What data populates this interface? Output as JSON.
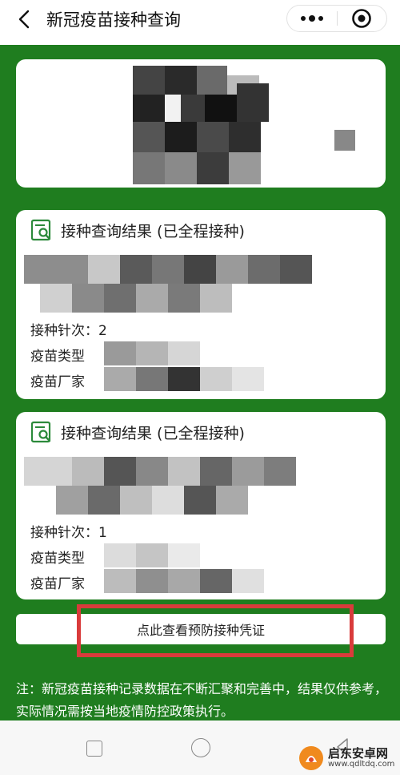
{
  "header": {
    "title": "新冠疫苗接种查询"
  },
  "colors": {
    "green": "#1f7d1f",
    "highlight": "#d93b3b",
    "icon_green": "#2c8a3b"
  },
  "results": [
    {
      "title": "接种查询结果 (已全程接种)",
      "dose_label": "接种针次：2",
      "type_label": "疫苗类型",
      "maker_label": "疫苗厂家"
    },
    {
      "title": "接种查询结果 (已全程接种)",
      "dose_label": "接种针次：1",
      "type_label": "疫苗类型",
      "maker_label": "疫苗厂家"
    }
  ],
  "voucher_button": {
    "label": "点此查看预防接种凭证"
  },
  "note": "注：新冠疫苗接种记录数据在不断汇聚和完善中，结果仅供参考，实际情况需按当地疫情防控政策执行。",
  "watermark": {
    "name": "启东安卓网",
    "url": "www.qdltdq.com"
  }
}
